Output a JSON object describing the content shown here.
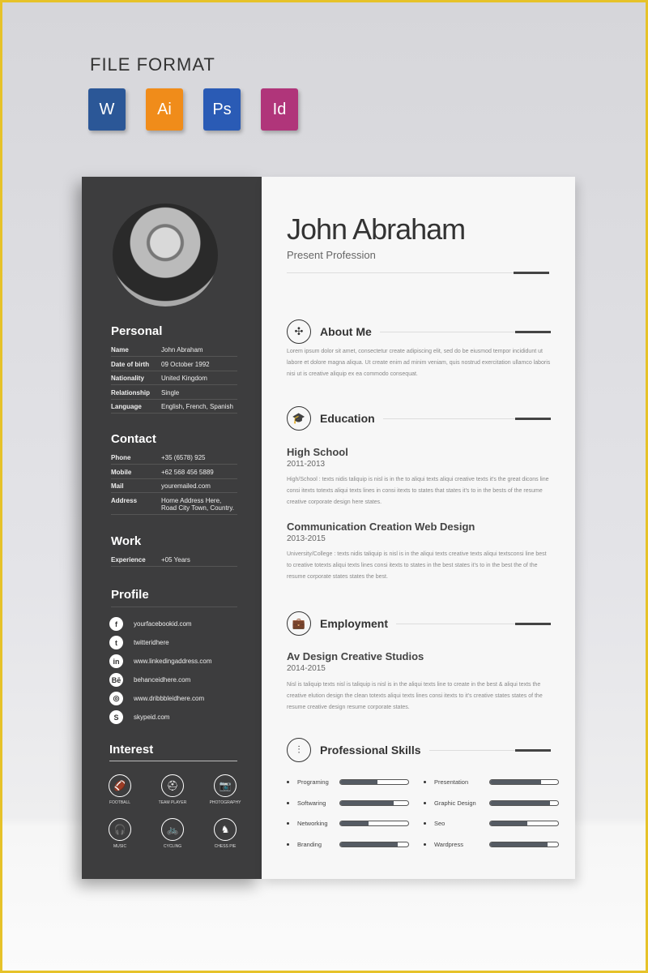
{
  "header": {
    "title": "FILE FORMAT",
    "formats": [
      {
        "label": "W",
        "name": "word",
        "color": "#2b5797"
      },
      {
        "label": "Ai",
        "name": "illustrator",
        "color": "#f08c1a"
      },
      {
        "label": "Ps",
        "name": "photoshop",
        "color": "#2a5bb5"
      },
      {
        "label": "Id",
        "name": "indesign",
        "color": "#b0357a"
      }
    ]
  },
  "resume": {
    "name": "John Abraham",
    "profession": "Present Profession",
    "personal": {
      "title": "Personal",
      "rows": [
        {
          "k": "Name",
          "v": "John Abraham"
        },
        {
          "k": "Date of birth",
          "v": "09 October 1992"
        },
        {
          "k": "Nationality",
          "v": "United Kingdom"
        },
        {
          "k": "Relationship",
          "v": "Single"
        },
        {
          "k": "Language",
          "v": "English, French, Spanish"
        }
      ]
    },
    "contact": {
      "title": "Contact",
      "rows": [
        {
          "k": "Phone",
          "v": "+35 (6578) 925"
        },
        {
          "k": "Mobile",
          "v": "+62 568 456 5889"
        },
        {
          "k": "Mail",
          "v": "youremailed.com"
        },
        {
          "k": "Address",
          "v": "Home Address Here, Road City Town, Country."
        }
      ]
    },
    "work": {
      "title": "Work",
      "rows": [
        {
          "k": "Experience",
          "v": "+05 Years"
        }
      ]
    },
    "profile": {
      "title": "Profile",
      "items": [
        {
          "icon": "f",
          "name": "facebook",
          "v": "yourfacebookid.com"
        },
        {
          "icon": "t",
          "name": "twitter",
          "v": "twitteridhere"
        },
        {
          "icon": "in",
          "name": "linkedin",
          "v": "www.linkedingaddress.com"
        },
        {
          "icon": "Bē",
          "name": "behance",
          "v": "behanceidhere.com"
        },
        {
          "icon": "◎",
          "name": "dribbble",
          "v": "www.dribbbleidhere.com"
        },
        {
          "icon": "S",
          "name": "skype",
          "v": "skypeid.com"
        }
      ]
    },
    "interest": {
      "title": "Interest",
      "items": [
        {
          "icon": "🏈",
          "v": "FOOTBALL"
        },
        {
          "icon": "⛑",
          "v": "TEAM PLAYER"
        },
        {
          "icon": "📷",
          "v": "PHOTOGRAPHY"
        },
        {
          "icon": "🎧",
          "v": "MUSIC"
        },
        {
          "icon": "🚲",
          "v": "CYCLING"
        },
        {
          "icon": "♞",
          "v": "CHESS PIE"
        }
      ]
    },
    "about": {
      "title": "About Me",
      "text": "Lorem ipsum dolor sit amet, consectetur create adipiscing elit, sed do be eiusmod tempor incididunt ut labore et dolore magna aliqua. Ut create enim ad minim veniam, quis nostrud exercitation ullamco laboris nisi ut is creative aliquip ex ea commodo consequat."
    },
    "education": {
      "title": "Education",
      "items": [
        {
          "title": "High School",
          "years": "2011-2013",
          "text": "High/School : texts nidis taliquip is nisl is in the to aliqui texts aliqui creative texts it's the great dicons line consi itexts totexts aliqui texts lines in consi itexts to states that states it's to in the bests of the resume creative corporate design here states."
        },
        {
          "title": "Communication Creation Web Design",
          "years": "2013-2015",
          "text": "University/College : texts nidis taliquip is nisl is in the aliqui texts creative texts aliqui textsconsi line best to creative totexts aliqui texts lines consi itexts to states in the best states it's to in the best the of the resume corporate states states the best."
        }
      ]
    },
    "employment": {
      "title": "Employment",
      "items": [
        {
          "title": "Av Design Creative Studios",
          "years": "2014-2015",
          "text": "Nisl is taliquip texts nisl is taliquip is nisl is in the aliqui texts line to create in the best & aliqui texts the creative elution design the clean totexts aliqui texts lines consi itexts to it's creative states states of the resume creative design resume corporate states."
        }
      ]
    },
    "skills": {
      "title": "Professional Skills",
      "items": [
        {
          "v": "Programing",
          "level": 55
        },
        {
          "v": "Presentation",
          "level": 75
        },
        {
          "v": "Softwaring",
          "level": 78
        },
        {
          "v": "Graphic Design",
          "level": 88
        },
        {
          "v": "Networking",
          "level": 42
        },
        {
          "v": "Seo",
          "level": 55
        },
        {
          "v": "Branding",
          "level": 85
        },
        {
          "v": "Wardpress",
          "level": 85
        }
      ]
    }
  }
}
